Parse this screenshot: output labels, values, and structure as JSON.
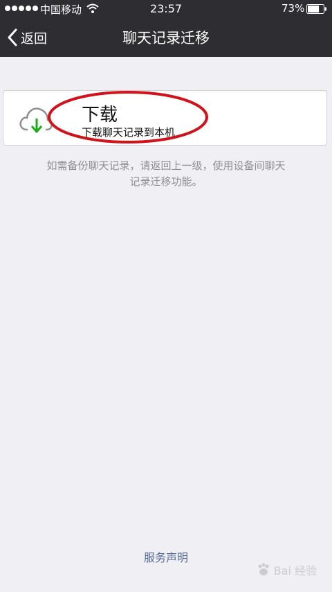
{
  "status_bar": {
    "carrier": "中国移动",
    "time": "23:57",
    "battery_percent": "73%",
    "battery_level": 0.73,
    "signal_bars": 5
  },
  "nav": {
    "back_label": "返回",
    "title": "聊天记录迁移"
  },
  "download_cell": {
    "icon": "cloud-download-icon",
    "title": "下载",
    "subtitle": "下载聊天记录到本机"
  },
  "info": {
    "line1": "如需备份聊天记录，请返回上一级，使用设备间聊天",
    "line2": "记录迁移功能。"
  },
  "footer": {
    "service_link": "服务声明"
  },
  "watermark": {
    "text": "Bai  经验"
  },
  "colors": {
    "nav_background": "#2e2e32",
    "page_background": "#efeff4",
    "link": "#576b95",
    "download_arrow": "#1aad19",
    "annotation_circle": "#d0121b"
  }
}
